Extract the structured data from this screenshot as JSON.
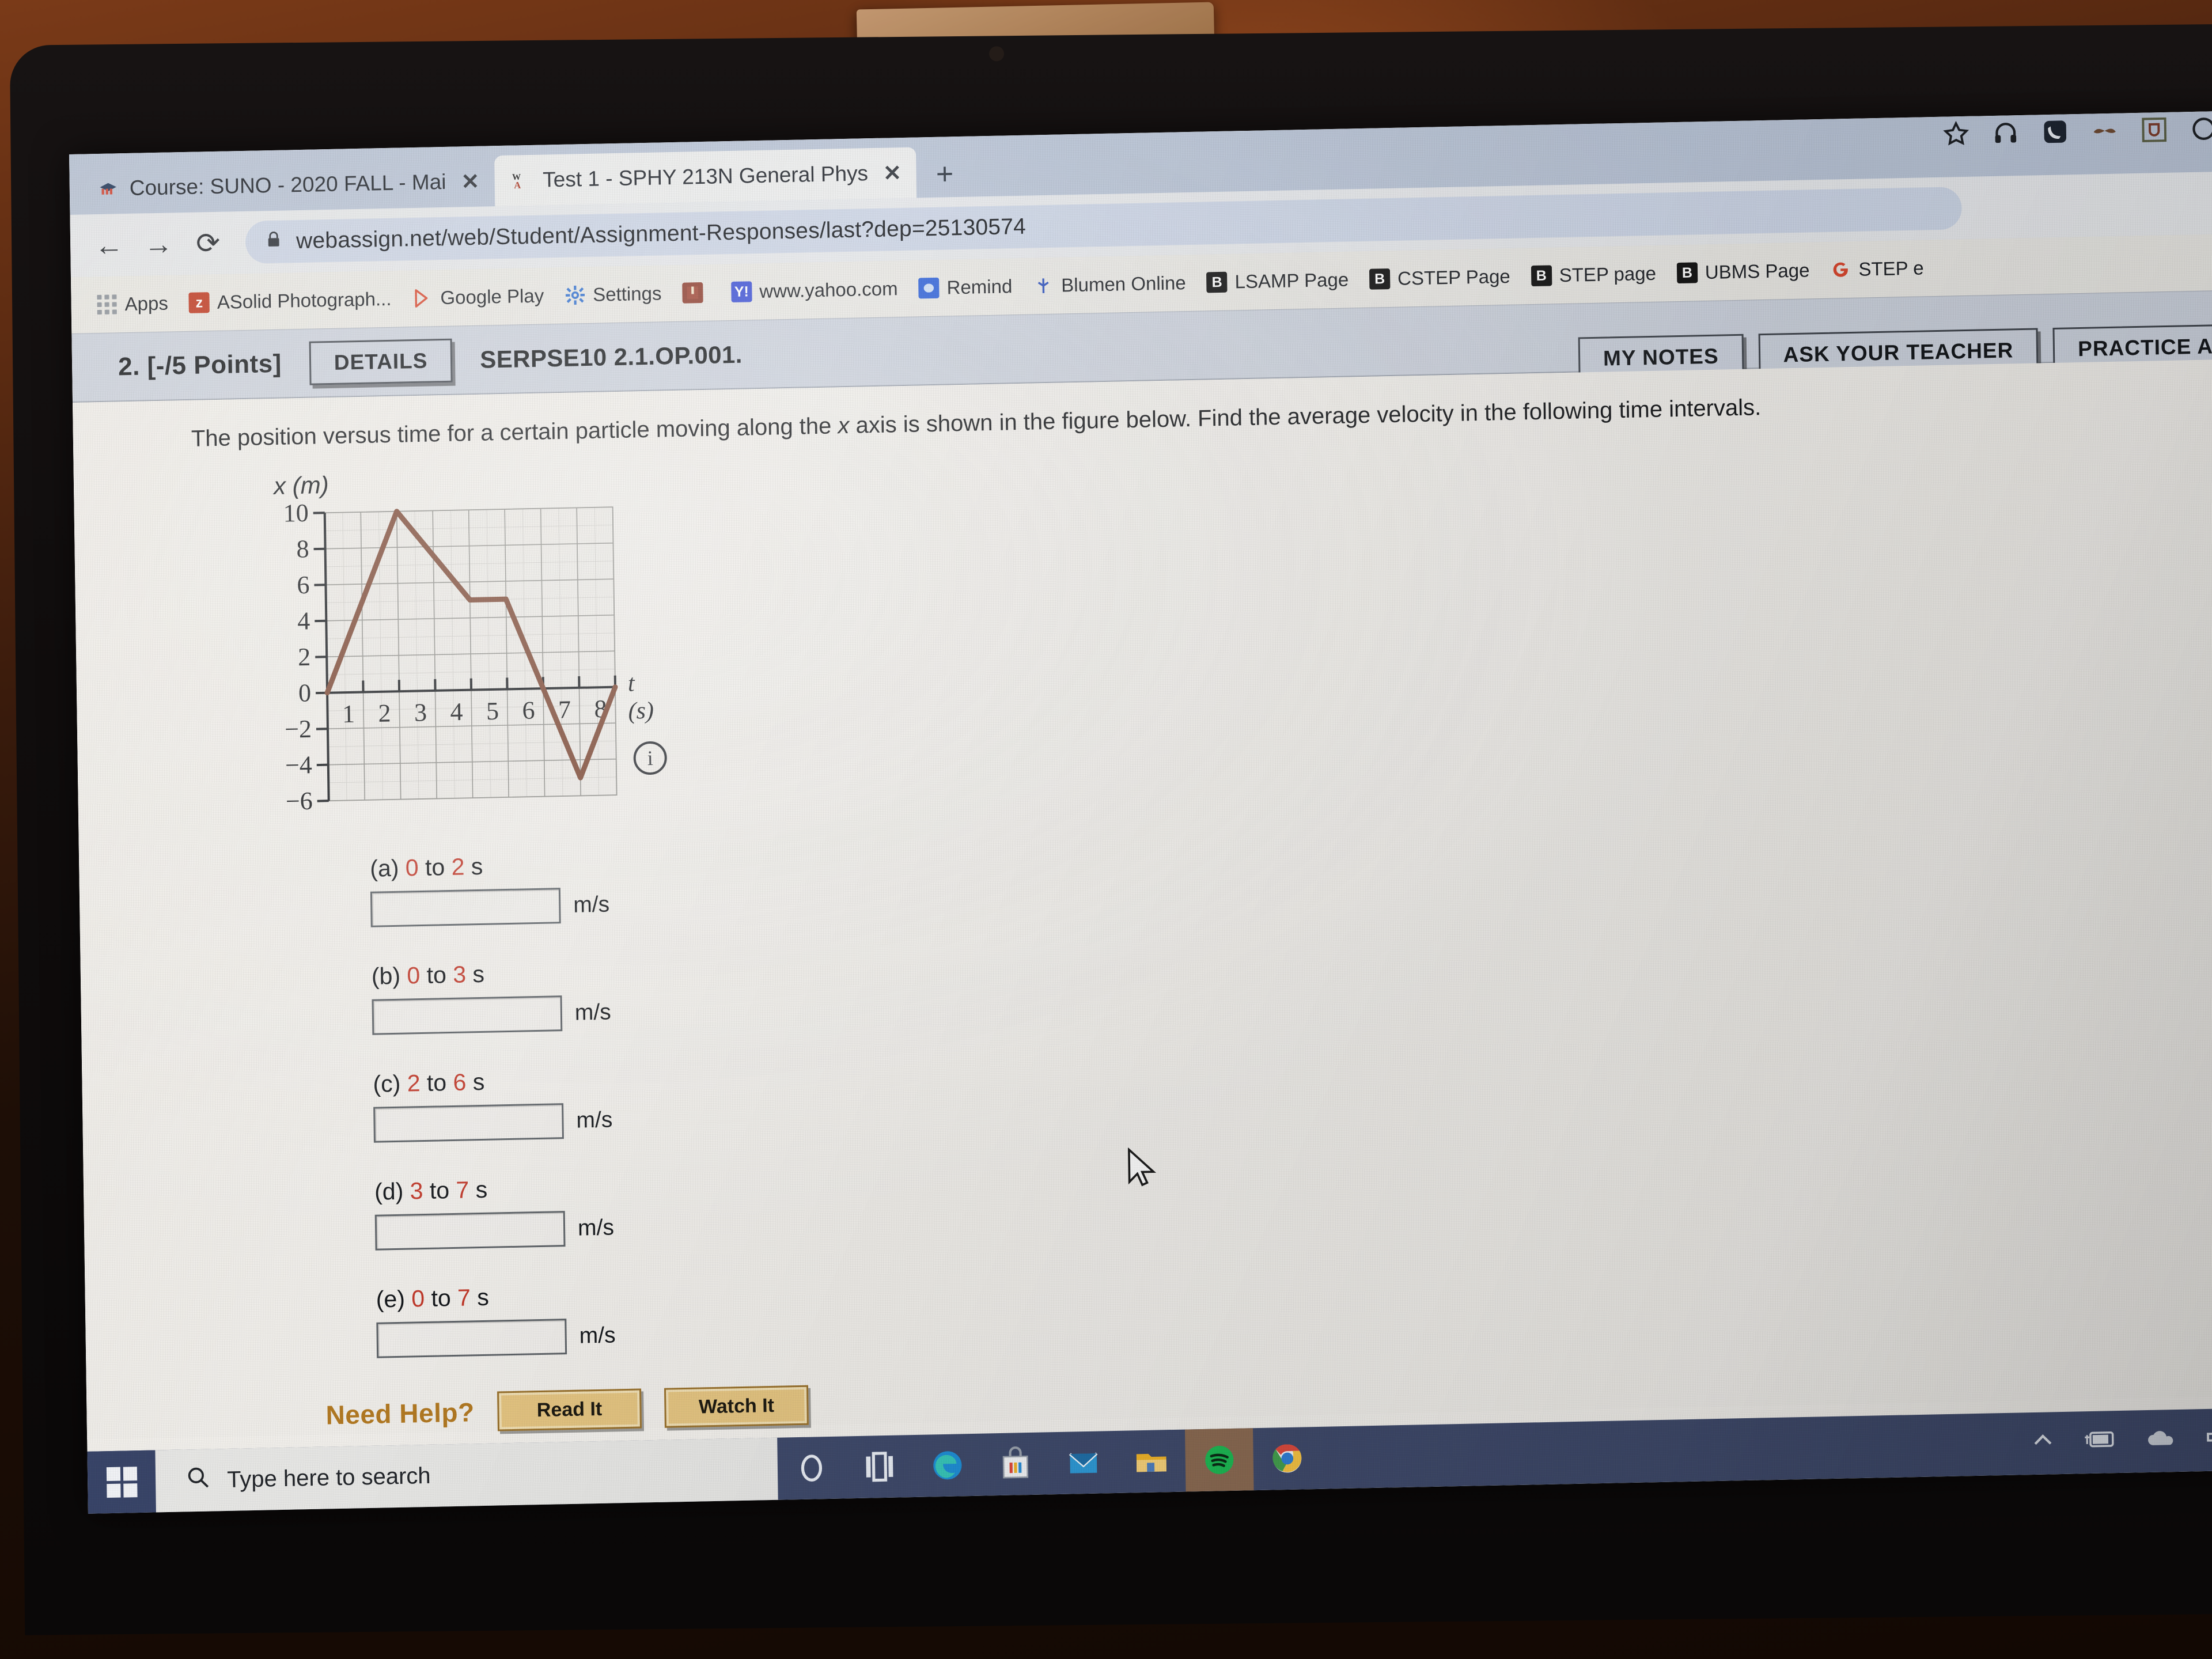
{
  "browser": {
    "tabs": [
      {
        "title": "Course: SUNO - 2020 FALL - Mai",
        "favicon": "moodle-icon",
        "close": "✕",
        "active": false
      },
      {
        "title": "Test 1 - SPHY 213N General Phys",
        "favicon": "webassign-icon",
        "close": "✕",
        "active": true
      }
    ],
    "new_tab_label": "+",
    "nav": {
      "back": "←",
      "forward": "→",
      "reload": "⟳"
    },
    "omnibox": {
      "lock": "🔒",
      "url": "webassign.net/web/Student/Assignment-Responses/last?dep=25130574"
    },
    "bookmarks": [
      {
        "label": "Apps",
        "icon": "apps-grid-icon"
      },
      {
        "label": "ASolid Photograph...",
        "icon": "z-icon"
      },
      {
        "label": "Google Play",
        "icon": "google-play-icon"
      },
      {
        "label": "Settings",
        "icon": "gear-icon"
      },
      {
        "label": "",
        "icon": "book-icon"
      },
      {
        "label": "www.yahoo.com",
        "icon": "yahoo-icon"
      },
      {
        "label": "Remind",
        "icon": "remind-icon"
      },
      {
        "label": "Blumen Online",
        "icon": "blumen-icon"
      },
      {
        "label": "LSAMP Page",
        "icon": "blackboard-icon"
      },
      {
        "label": "CSTEP Page",
        "icon": "blackboard-icon"
      },
      {
        "label": "STEP page",
        "icon": "blackboard-icon"
      },
      {
        "label": "UBMS Page",
        "icon": "blackboard-icon"
      },
      {
        "label": "STEP e",
        "icon": "google-icon"
      }
    ],
    "extensions": [
      "bookmark-star-icon",
      "headphones-icon",
      "phone-icon",
      "mustache-icon",
      "boxed-extension-icon",
      "profile-icon"
    ]
  },
  "question": {
    "number_label": "2.  [-/5 Points]",
    "details_button": "DETAILS",
    "code": "SERPSE10 2.1.OP.001.",
    "actions": [
      "MY NOTES",
      "ASK YOUR TEACHER",
      "PRACTICE A"
    ],
    "stem_part1": "The position versus time for a certain particle moving along the ",
    "stem_italic": "x",
    "stem_part2": " axis is shown in the figure below. Find the average velocity in the following time intervals.",
    "info_icon_label": "i",
    "parts": [
      {
        "tag": "(a)",
        "from": "0",
        "mid": " to ",
        "to": "2",
        "suffix": " s",
        "value": "",
        "unit": "m/s"
      },
      {
        "tag": "(b)",
        "from": "0",
        "mid": " to ",
        "to": "3",
        "suffix": " s",
        "value": "",
        "unit": "m/s"
      },
      {
        "tag": "(c)",
        "from": "2",
        "mid": " to ",
        "to": "6",
        "suffix": " s",
        "value": "",
        "unit": "m/s"
      },
      {
        "tag": "(d)",
        "from": "3",
        "mid": " to ",
        "to": "7",
        "suffix": " s",
        "value": "",
        "unit": "m/s"
      },
      {
        "tag": "(e)",
        "from": "0",
        "mid": " to ",
        "to": "7",
        "suffix": " s",
        "value": "",
        "unit": "m/s"
      }
    ],
    "need_help_label": "Need Help?",
    "help_buttons": [
      "Read It",
      "Watch It"
    ]
  },
  "chart_data": {
    "type": "line",
    "title": "",
    "ylabel": "x (m)",
    "xlabel": "t (s)",
    "xlim": [
      0,
      8
    ],
    "ylim": [
      -6,
      10
    ],
    "xticks": [
      1,
      2,
      3,
      4,
      5,
      6,
      7,
      8
    ],
    "yticks": [
      -6,
      -4,
      -2,
      0,
      2,
      4,
      6,
      8,
      10
    ],
    "grid": true,
    "legend": "none",
    "line_color": "#7a4430",
    "series": [
      {
        "name": "position",
        "x": [
          0,
          2,
          4,
          5,
          7,
          8
        ],
        "y": [
          0,
          10,
          5,
          5,
          -5,
          0
        ]
      }
    ]
  },
  "taskbar": {
    "start_icon": "windows-logo-icon",
    "search_placeholder": "Type here to search",
    "search_icon": "magnifier-icon",
    "apps": [
      "cortana-icon",
      "task-view-icon",
      "edge-icon",
      "microsoft-store-icon",
      "mail-icon",
      "file-explorer-icon",
      "spotify-icon",
      "chrome-icon"
    ],
    "tray": [
      "chevron-up-icon",
      "battery-charging-icon",
      "onedrive-cloud-icon",
      "volume-icon"
    ]
  }
}
